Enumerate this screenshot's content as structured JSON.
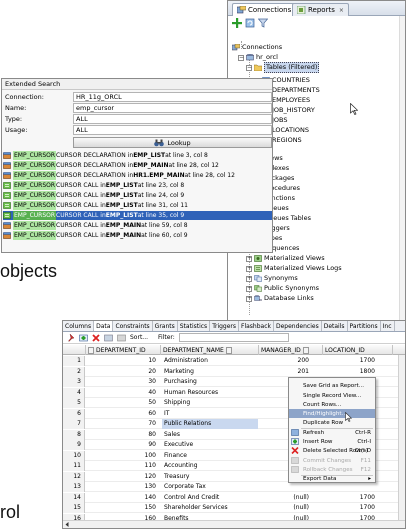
{
  "connections": {
    "tabs": [
      {
        "label": "Connections",
        "close": "×"
      },
      {
        "label": "Reports",
        "close": "×"
      }
    ],
    "tree": {
      "root": "Connections",
      "connection": "hr_orcl",
      "tables_node": "Tables (Filtered)",
      "tables": [
        "COUNTRIES",
        "DEPARTMENTS",
        "EMPLOYEES",
        "JOB_HISTORY",
        "JOBS",
        "LOCATIONS",
        "REGIONS"
      ],
      "folders": [
        "Views",
        "Indexes",
        "Packages",
        "Procedures",
        "Functions",
        "Queues",
        "Queues Tables",
        "Triggers",
        "Types",
        "Sequences",
        "Materialized Views",
        "Materialized Views Logs",
        "Synonyms",
        "Public Synonyms",
        "Database Links"
      ]
    }
  },
  "search": {
    "header": "Extended Search",
    "fields": [
      {
        "label": "Connection:",
        "value": "HR_11g_ORCL"
      },
      {
        "label": "Name:",
        "value": "emp_cursor"
      },
      {
        "label": "Type:",
        "value": "ALL"
      },
      {
        "label": "Usage:",
        "value": "ALL"
      }
    ],
    "lookup_label": "Lookup",
    "results": [
      {
        "kw": "EMP_CURSOR",
        "pre": " CURSOR DECLARATION in ",
        "obj": "EMP_LIST",
        "post": " at line 3, col 8",
        "icon": "package"
      },
      {
        "kw": "EMP_CURSOR",
        "pre": " CURSOR DECLARATION in ",
        "obj": "EMP_MAIN",
        "post": " at line 28, col 12",
        "icon": "package"
      },
      {
        "kw": "EMP_CURSOR",
        "pre": " CURSOR DECLARATION in ",
        "obj": "HR1.EMP_MAIN",
        "post": " at line 28, col 12",
        "icon": "package"
      },
      {
        "kw": "EMP_CURSOR",
        "pre": " CURSOR CALL in ",
        "obj": "EMP_LIST",
        "post": " at line 23, col 8",
        "icon": "call"
      },
      {
        "kw": "EMP_CURSOR",
        "pre": " CURSOR CALL in ",
        "obj": "EMP_LIST",
        "post": " at line 24, col 9",
        "icon": "call"
      },
      {
        "kw": "EMP_CURSOR",
        "pre": " CURSOR CALL in ",
        "obj": "EMP_LIST",
        "post": " at line 31, col 11",
        "icon": "call"
      },
      {
        "kw": "EMP_CURSOR",
        "pre": " CURSOR CALL in ",
        "obj": "EMP_LIST",
        "post": " at line 35, col 9",
        "icon": "call"
      },
      {
        "kw": "EMP_CURSOR",
        "pre": " CURSOR CALL in ",
        "obj": "EMP_MAIN",
        "post": " at line 59, col 8",
        "icon": "package"
      },
      {
        "kw": "EMP_CURSOR",
        "pre": " CURSOR CALL in ",
        "obj": "EMP_MAIN",
        "post": " at line 60, col 9",
        "icon": "package"
      }
    ],
    "selected_result": 6
  },
  "fragments": {
    "objects": "objects",
    "rol": "rol"
  },
  "grid": {
    "tabs": [
      "Columns",
      "Data",
      "Constraints",
      "Grants",
      "Statistics",
      "Triggers",
      "Flashback",
      "Dependencies",
      "Details",
      "Partitions",
      "Inc"
    ],
    "toolbar": {
      "sort_label": "Sort...",
      "filter_label": "Filter:"
    },
    "columns": [
      "DEPARTMENT_ID",
      "DEPARTMENT_NAME",
      "MANAGER_ID",
      "LOCATION_ID"
    ],
    "rows": [
      [
        "1",
        "10",
        "Administration",
        "200",
        "1700"
      ],
      [
        "2",
        "20",
        "Marketing",
        "201",
        "1800"
      ],
      [
        "3",
        "30",
        "Purchasing",
        "",
        ""
      ],
      [
        "4",
        "40",
        "Human Resources",
        "",
        ""
      ],
      [
        "5",
        "50",
        "Shipping",
        "",
        ""
      ],
      [
        "6",
        "60",
        "IT",
        "",
        ""
      ],
      [
        "7",
        "70",
        "Public Relations",
        "",
        ""
      ],
      [
        "8",
        "80",
        "Sales",
        "",
        ""
      ],
      [
        "9",
        "90",
        "Executive",
        "",
        ""
      ],
      [
        "10",
        "100",
        "Finance",
        "",
        ""
      ],
      [
        "11",
        "110",
        "Accounting",
        "",
        ""
      ],
      [
        "12",
        "120",
        "Treasury",
        "",
        ""
      ],
      [
        "13",
        "130",
        "Corporate Tax",
        "",
        ""
      ],
      [
        "14",
        "140",
        "Control And Credit",
        "(null)",
        "1700"
      ],
      [
        "15",
        "150",
        "Shareholder Services",
        "(null)",
        "1700"
      ],
      [
        "16",
        "160",
        "Benefits",
        "(null)",
        "1700"
      ]
    ],
    "highlight_row": 6
  },
  "context_menu": {
    "items": [
      {
        "label": "Save Grid as Report...",
        "shortcut": "",
        "state": "normal"
      },
      {
        "label": "Single Record View...",
        "shortcut": "",
        "state": "normal"
      },
      {
        "label": "Count Rows...",
        "shortcut": "",
        "state": "normal"
      },
      {
        "label": "Find/Highlight...",
        "shortcut": "",
        "state": "hover"
      },
      {
        "label": "Duplicate Row",
        "shortcut": "",
        "state": "normal"
      },
      {
        "label": "Refresh",
        "shortcut": "Ctrl-R",
        "state": "normal"
      },
      {
        "label": "Insert Row",
        "shortcut": "Ctrl-I",
        "state": "normal"
      },
      {
        "label": "Delete Selected Row(s)",
        "shortcut": "Ctrl-D",
        "state": "normal"
      },
      {
        "label": "Commit Changes",
        "shortcut": "F11",
        "state": "disabled"
      },
      {
        "label": "Rollback Changes",
        "shortcut": "F12",
        "state": "disabled"
      },
      {
        "label": "Export Data",
        "shortcut": "▸",
        "state": "normal"
      }
    ]
  },
  "colors": {
    "selection": "#2f62b8",
    "highlight": "#c9d8ef",
    "keyword_bg": "#aee6a2",
    "menu_hover": "#8da4c9"
  }
}
